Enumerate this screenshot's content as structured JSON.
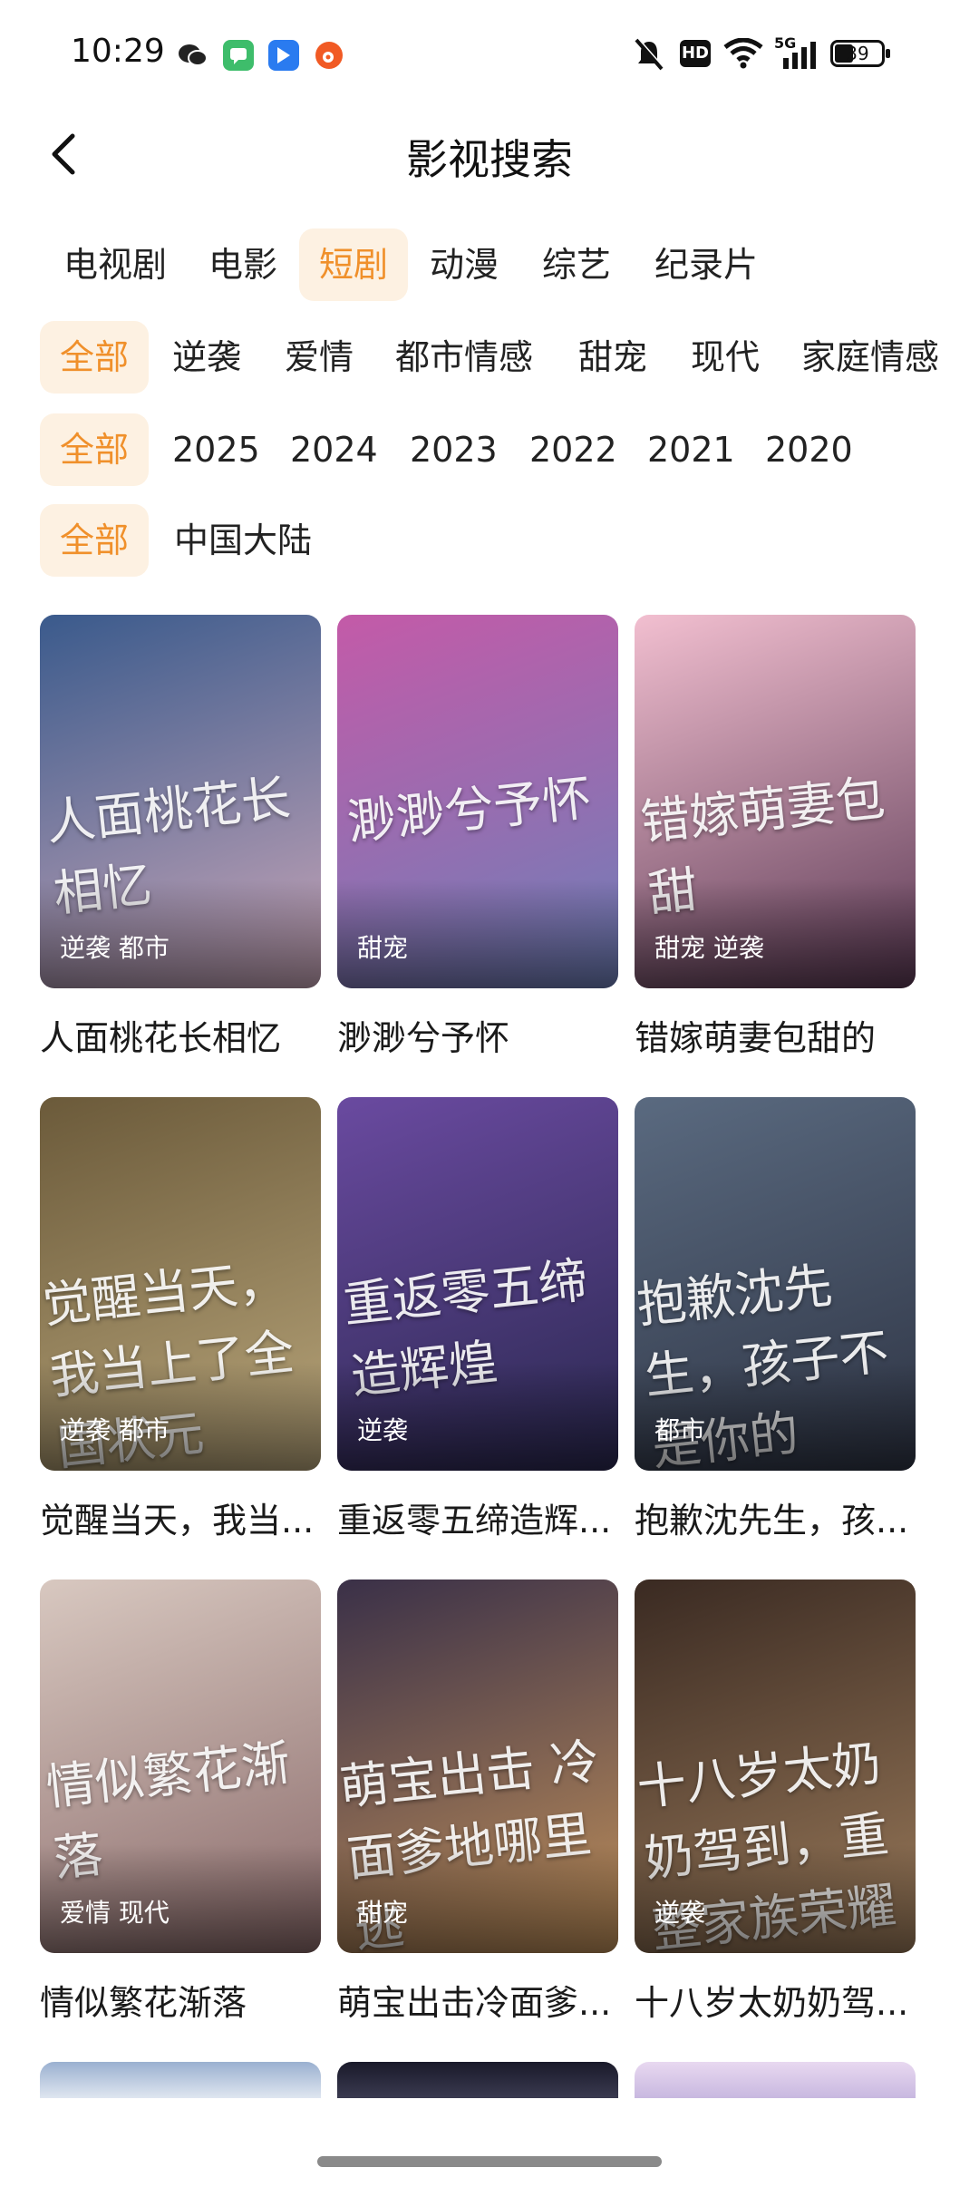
{
  "status_bar": {
    "time": "10:29",
    "battery": "39",
    "network_label": "5G",
    "hd_label": "HD",
    "notification_icons": [
      "wechat-icon",
      "messages-icon",
      "app-icon",
      "weibo-icon"
    ]
  },
  "header": {
    "title": "影视搜索"
  },
  "category_tabs": [
    {
      "label": "电视剧"
    },
    {
      "label": "电影"
    },
    {
      "label": "短剧",
      "active": true
    },
    {
      "label": "动漫"
    },
    {
      "label": "综艺"
    },
    {
      "label": "纪录片"
    }
  ],
  "genre_filters": [
    {
      "label": "全部",
      "active": true
    },
    {
      "label": "逆袭"
    },
    {
      "label": "爱情"
    },
    {
      "label": "都市情感"
    },
    {
      "label": "甜宠"
    },
    {
      "label": "现代"
    },
    {
      "label": "家庭情感"
    }
  ],
  "year_filters": [
    {
      "label": "全部",
      "active": true
    },
    {
      "label": "2025"
    },
    {
      "label": "2024"
    },
    {
      "label": "2023"
    },
    {
      "label": "2022"
    },
    {
      "label": "2021"
    },
    {
      "label": "2020"
    }
  ],
  "region_filters": [
    {
      "label": "全部",
      "active": true
    },
    {
      "label": "中国大陆"
    }
  ],
  "items": [
    {
      "title": "人面桃花长相忆",
      "tag": "逆袭 都市",
      "poster_text": "人面桃花长相忆",
      "colors": [
        "#3a5a8c",
        "#c9a6b8"
      ]
    },
    {
      "title": "渺渺兮予怀",
      "tag": "甜宠",
      "poster_text": "渺渺兮予怀",
      "colors": [
        "#c45aa8",
        "#6d7fb8"
      ]
    },
    {
      "title": "错嫁萌妻包甜的",
      "tag": "甜宠 逆袭",
      "poster_text": "错嫁萌妻包甜",
      "colors": [
        "#f2bfd0",
        "#5c3a55"
      ]
    },
    {
      "title": "觉醒当天，我当...",
      "tag": "逆袭 都市",
      "poster_text": "觉醒当天，我当上了全国状元",
      "colors": [
        "#6b5a3a",
        "#b8a57a"
      ]
    },
    {
      "title": "重返零五缔造辉...",
      "tag": "逆袭",
      "poster_text": "重返零五缔造辉煌",
      "colors": [
        "#6a4aa0",
        "#2a2850"
      ]
    },
    {
      "title": "抱歉沈先生，孩...",
      "tag": "都市",
      "poster_text": "抱歉沈先生，孩子不是你的",
      "colors": [
        "#5a6a80",
        "#2e3444"
      ]
    },
    {
      "title": "情似繁花渐落",
      "tag": "爱情 现代",
      "poster_text": "情似繁花渐落",
      "colors": [
        "#d8c8c0",
        "#8a6a6a"
      ]
    },
    {
      "title": "萌宝出击冷面爹...",
      "tag": "甜宠",
      "poster_text": "萌宝出击 冷面爹地哪里逃",
      "colors": [
        "#3a3048",
        "#c0905a"
      ]
    },
    {
      "title": "十八岁太奶奶驾...",
      "tag": "逆袭",
      "poster_text": "十八岁太奶奶驾到，重整家族荣耀",
      "colors": [
        "#3a2a22",
        "#9a7a5a"
      ]
    }
  ],
  "next_row_colors": [
    [
      "#9ab0d0",
      "#dfe6f0"
    ],
    [
      "#1a1a2a",
      "#3a3a50"
    ],
    [
      "#e8d8f0",
      "#c8b8e0"
    ]
  ]
}
